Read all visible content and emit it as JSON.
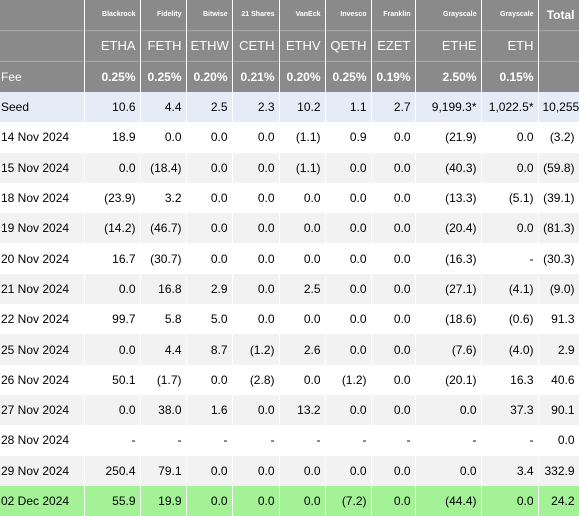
{
  "table": {
    "issuers": [
      "Blackrock",
      "Fidelity",
      "Bitwise",
      "21 Shares",
      "VanEck",
      "Invesco",
      "Franklin",
      "Grayscale",
      "Grayscale"
    ],
    "total_label": "Total",
    "tickers": [
      "ETHA",
      "FETH",
      "ETHW",
      "CETH",
      "ETHV",
      "QETH",
      "EZET",
      "ETHE",
      "ETH"
    ],
    "fee_label": "Fee",
    "fees": [
      "0.25%",
      "0.25%",
      "0.20%",
      "0.21%",
      "0.20%",
      "0.25%",
      "0.19%",
      "2.50%",
      "0.15%"
    ],
    "rows": [
      {
        "label": "Seed",
        "cells": [
          "10.6",
          "4.4",
          "2.5",
          "2.3",
          "10.2",
          "1.1",
          "2.7",
          "9,199.3*",
          "1,022.5*",
          "10,255"
        ]
      },
      {
        "label": "14 Nov 2024",
        "cells": [
          "18.9",
          "0.0",
          "0.0",
          "0.0",
          "(1.1)",
          "0.9",
          "0.0",
          "(21.9)",
          "0.0",
          "(3.2)"
        ]
      },
      {
        "label": "15 Nov 2024",
        "cells": [
          "0.0",
          "(18.4)",
          "0.0",
          "0.0",
          "(1.1)",
          "0.0",
          "0.0",
          "(40.3)",
          "0.0",
          "(59.8)"
        ]
      },
      {
        "label": "18 Nov 2024",
        "cells": [
          "(23.9)",
          "3.2",
          "0.0",
          "0.0",
          "0.0",
          "0.0",
          "0.0",
          "(13.3)",
          "(5.1)",
          "(39.1)"
        ]
      },
      {
        "label": "19 Nov 2024",
        "cells": [
          "(14.2)",
          "(46.7)",
          "0.0",
          "0.0",
          "0.0",
          "0.0",
          "0.0",
          "(20.4)",
          "0.0",
          "(81.3)"
        ]
      },
      {
        "label": "20 Nov 2024",
        "cells": [
          "16.7",
          "(30.7)",
          "0.0",
          "0.0",
          "0.0",
          "0.0",
          "0.0",
          "(16.3)",
          "-",
          "(30.3)"
        ]
      },
      {
        "label": "21 Nov 2024",
        "cells": [
          "0.0",
          "16.8",
          "2.9",
          "0.0",
          "2.5",
          "0.0",
          "0.0",
          "(27.1)",
          "(4.1)",
          "(9.0)"
        ]
      },
      {
        "label": "22 Nov 2024",
        "cells": [
          "99.7",
          "5.8",
          "5.0",
          "0.0",
          "0.0",
          "0.0",
          "0.0",
          "(18.6)",
          "(0.6)",
          "91.3"
        ]
      },
      {
        "label": "25 Nov 2024",
        "cells": [
          "0.0",
          "4.4",
          "8.7",
          "(1.2)",
          "2.6",
          "0.0",
          "0.0",
          "(7.6)",
          "(4.0)",
          "2.9"
        ]
      },
      {
        "label": "26 Nov 2024",
        "cells": [
          "50.1",
          "(1.7)",
          "0.0",
          "(2.8)",
          "0.0",
          "(1.2)",
          "0.0",
          "(20.1)",
          "16.3",
          "40.6"
        ]
      },
      {
        "label": "27 Nov 2024",
        "cells": [
          "0.0",
          "38.0",
          "1.6",
          "0.0",
          "13.2",
          "0.0",
          "0.0",
          "0.0",
          "37.3",
          "90.1"
        ]
      },
      {
        "label": "28 Nov 2024",
        "cells": [
          "-",
          "-",
          "-",
          "-",
          "-",
          "-",
          "-",
          "-",
          "-",
          "0.0"
        ]
      },
      {
        "label": "29 Nov 2024",
        "cells": [
          "250.4",
          "79.1",
          "0.0",
          "0.0",
          "0.0",
          "0.0",
          "0.0",
          "0.0",
          "3.4",
          "332.9"
        ]
      },
      {
        "label": "02 Dec 2024",
        "cells": [
          "55.9",
          "19.9",
          "0.0",
          "0.0",
          "0.0",
          "(7.2)",
          "0.0",
          "(44.4)",
          "0.0",
          "24.2"
        ]
      }
    ]
  },
  "colors": {
    "header_bg": "#8a8a8a",
    "seed_row_bg": "#e6ecf7",
    "latest_row_bg": "#a3f296",
    "alt_row_bg": "#f2f2f2",
    "negative_text": "#e01010"
  }
}
